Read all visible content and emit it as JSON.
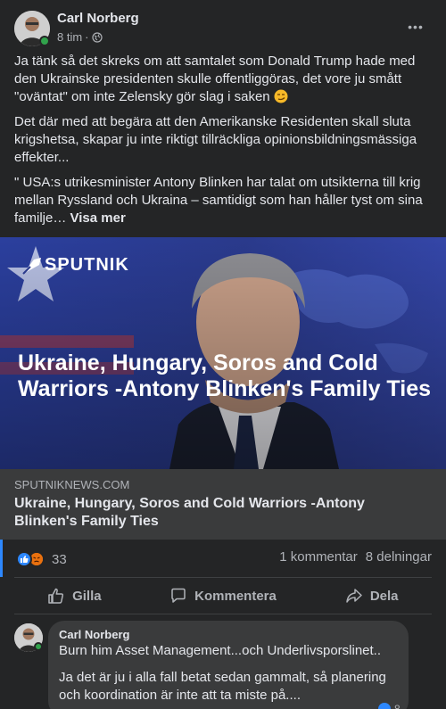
{
  "post": {
    "author": "Carl Norberg",
    "time": "8 tim",
    "separator": "·",
    "more_label": "•••",
    "paragraphs": [
      "Ja tänk så det skreks om att samtalet som Donald Trump hade med den Ukrainske presidenten skulle offentliggöras, det vore ju smått \"oväntat\" om inte Zelensky gör slag i saken",
      "Det där med att begära att den Amerikanske Residenten skall sluta krigshetsa, skapar ju inte riktigt tillräckliga opinionsbildningsmässiga effekter...",
      "\" USA:s utrikesminister Antony Blinken har talat om utsikterna till krig mellan Ryssland och Ukraina – samtidigt som han håller tyst om sina familje…"
    ],
    "see_more": "Visa mer"
  },
  "link": {
    "logo_text": "SPUTNIK",
    "image_headline": "Ukraine, Hungary, Soros and Cold Warriors -Antony Blinken's Family Ties",
    "domain": "SPUTNIKNEWS.COM",
    "title": "Ukraine, Hungary, Soros and Cold Warriors -Antony Blinken's Family Ties"
  },
  "stats": {
    "reaction_count": "33",
    "comments": "1 kommentar",
    "shares": "8 delningar"
  },
  "actions": {
    "like": "Gilla",
    "comment": "Kommentera",
    "share": "Dela"
  },
  "comment": {
    "author": "Carl Norberg",
    "lines": [
      "Burn him Asset Management...och Underlivsporslinet..",
      "Ja det är ju i alla fall betat sedan gammalt, så planering och koordination är inte att ta miste på...."
    ],
    "reaction_count": "8"
  },
  "colors": {
    "background": "#242526",
    "card": "#3a3b3c",
    "like_blue": "#2d88ff",
    "angry_orange": "#e9710f",
    "online_green": "#31a24c"
  },
  "icons": [
    "globe-icon",
    "more-icon",
    "like-icon",
    "angry-icon",
    "thumbs-up-icon",
    "comment-icon",
    "share-icon",
    "sputnik-logo-icon",
    "emoji-smirk-icon"
  ]
}
